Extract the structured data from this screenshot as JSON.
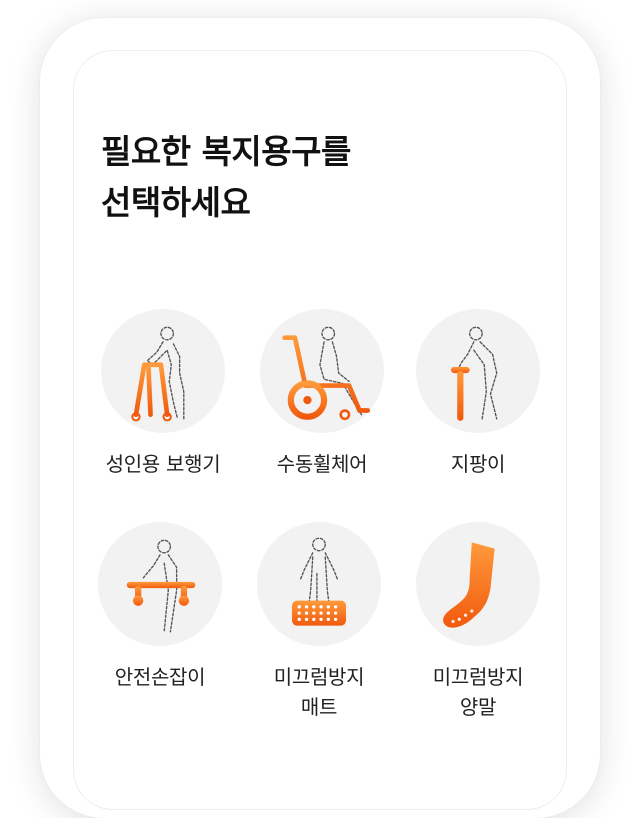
{
  "heading": {
    "line1": "필요한 복지용구를",
    "line2": "선택하세요"
  },
  "items": [
    {
      "label_lines": [
        "성인용 보행기"
      ],
      "icon": "walker-icon"
    },
    {
      "label_lines": [
        "수동휠체어"
      ],
      "icon": "wheelchair-icon"
    },
    {
      "label_lines": [
        "지팡이"
      ],
      "icon": "cane-icon"
    },
    {
      "label_lines": [
        "안전손잡이"
      ],
      "icon": "safety-handle-icon"
    },
    {
      "label_lines": [
        "미끄럼방지",
        "매트"
      ],
      "icon": "anti-slip-mat-icon"
    },
    {
      "label_lines": [
        "미끄럼방지",
        "양말"
      ],
      "icon": "anti-slip-socks-icon"
    }
  ],
  "colors": {
    "accent": "#F36B12",
    "accent_light": "#FF9A3C",
    "circle_bg": "#F2F2F2",
    "text": "#222222"
  }
}
